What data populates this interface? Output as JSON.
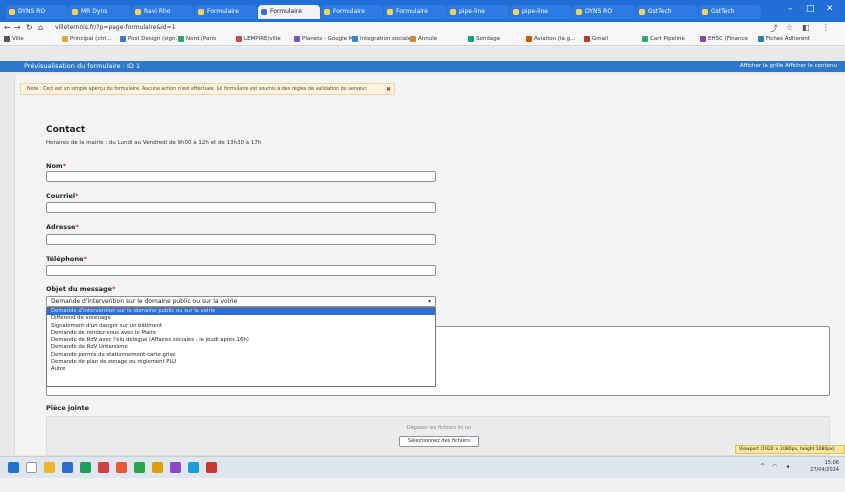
{
  "browser": {
    "tabs": [
      "DYNS RO",
      "MR Dyns",
      "Ravi Rho",
      "Formulaire",
      "Formulaire",
      "Formulaire",
      "Formulaire",
      "pipe-line",
      "pipe-line",
      "DYNS RO",
      "GstTech",
      "GstTech"
    ],
    "active_tab": 4,
    "url": "villeternois.fr/?p=page-formulaire&id=1",
    "bookmarks": [
      "Ville",
      "Principal (ctrl...",
      "Post Design (sign...",
      "Nord (Paris",
      "LEMPIRE/ville",
      "Planets - Google M...",
      "Integration sociale...",
      "Annule",
      "Sondage",
      "Aviation (la g...",
      "Gmail",
      "Cart Pipeline",
      "EHSC (Finance",
      "Fiches Adherent"
    ]
  },
  "app": {
    "title": "Prévisualisation du formulaire : ID 1",
    "right_links": "Afficher la grille   Afficher le contenu"
  },
  "note": {
    "text": "Note : Ceci est un simple aperçu du formulaire. Aucune action n'est effectuée. Le formulaire est soumis à des règles de validation du serveur."
  },
  "form": {
    "title": "Contact",
    "hours": "Horaires de la mairie : du Lundi au Vendredi de 9h00 à 12h et de 13h30 à 17h",
    "fields": [
      {
        "label": "Nom"
      },
      {
        "label": "Courriel"
      },
      {
        "label": "Adresse"
      },
      {
        "label": "Téléphone"
      }
    ],
    "subject": {
      "label": "Objet du message",
      "selected": "Demande d'intervention sur le domaine public ou sur la voirie",
      "options": [
        "Demande d'intervention sur le domaine public ou sur la voirie",
        "Différend de voisinage",
        "Signalement d'un danger sur un bâtiment",
        "Demande de rendez-vous avec le Maire",
        "Demande de RdV avec l'élu délégué (Affaires sociales - le jeudi après 16h)",
        "Demande de RdV Urbanisme",
        "Demande permis de stationnement-carte grise",
        "Demande de plan de zonage ou règlement PLU",
        "Autre"
      ]
    },
    "attachments": {
      "label": "Pièce jointe",
      "drop_text": "Déposer les fichiers ici ou",
      "button": "Sélectionnez des fichiers"
    }
  },
  "viewport_badge": "Viewport (1920 × 1080px, height 1080px)",
  "clock": {
    "time": "15:06",
    "date": "27/04/2024"
  }
}
